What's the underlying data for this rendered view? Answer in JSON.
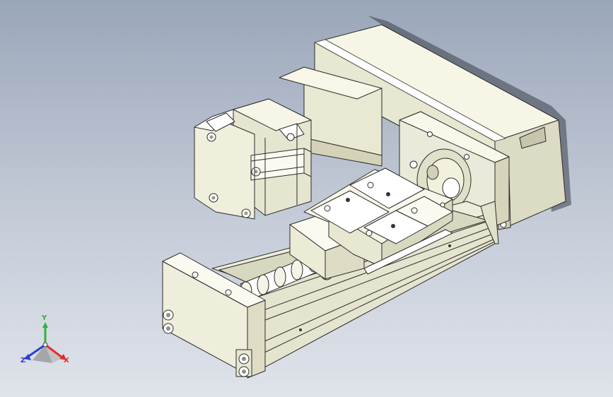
{
  "viewport": {
    "background_top": "#9aa6b9",
    "background_bottom": "#dfe3ea",
    "part_color": "#f1f0dc",
    "shadow_color": "#2a2e36"
  },
  "triad": {
    "x_label": "X",
    "y_label": "Y",
    "z_label": "Z",
    "x_color": "#e0302a",
    "y_color": "#2eb33a",
    "z_color": "#2a3fd8"
  }
}
